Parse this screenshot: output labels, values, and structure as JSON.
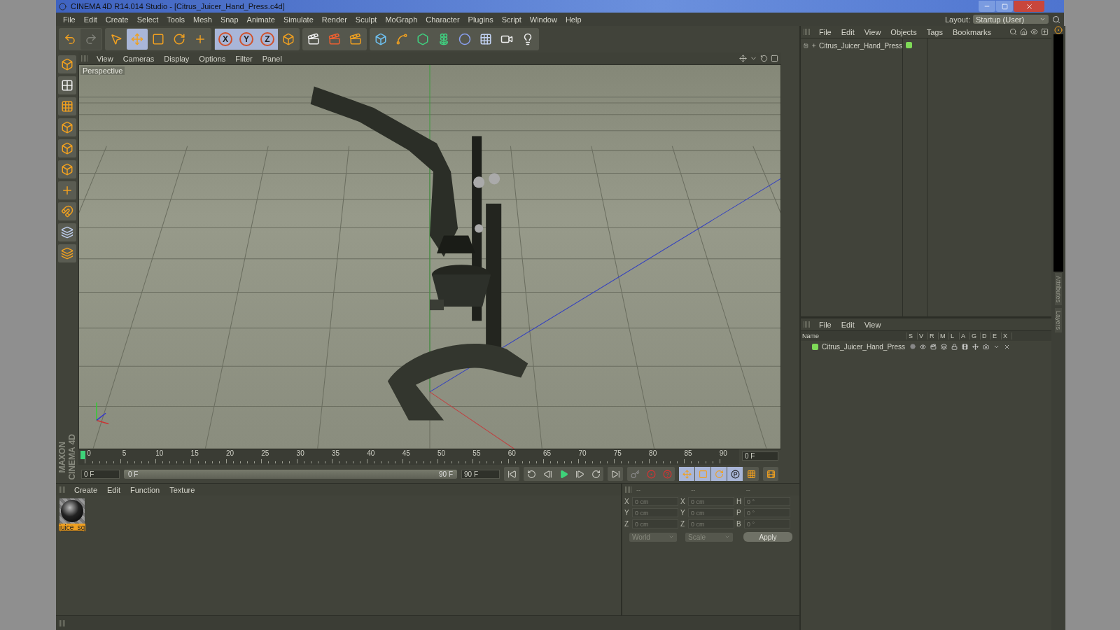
{
  "window": {
    "title": "CINEMA 4D R14.014 Studio - [Citrus_Juicer_Hand_Press.c4d]"
  },
  "menu": [
    "File",
    "Edit",
    "Create",
    "Select",
    "Tools",
    "Mesh",
    "Snap",
    "Animate",
    "Simulate",
    "Render",
    "Sculpt",
    "MoGraph",
    "Character",
    "Plugins",
    "Script",
    "Window",
    "Help"
  ],
  "layout": {
    "label": "Layout:",
    "value": "Startup (User)"
  },
  "toolbar": {
    "history": [
      {
        "kind": "undo",
        "disabled": false
      },
      {
        "kind": "redo",
        "disabled": true
      }
    ],
    "modes": [
      {
        "kind": "select",
        "selected": false
      },
      {
        "kind": "move",
        "selected": true
      },
      {
        "kind": "scale",
        "selected": false
      },
      {
        "kind": "rotate",
        "selected": false
      },
      {
        "kind": "recent",
        "selected": false
      }
    ],
    "axes": [
      {
        "label": "X",
        "selected": true
      },
      {
        "label": "Y",
        "selected": true
      },
      {
        "label": "Z",
        "selected": true
      }
    ]
  },
  "viewport": {
    "menu": [
      "View",
      "Cameras",
      "Display",
      "Options",
      "Filter",
      "Panel"
    ],
    "label": "Perspective"
  },
  "timeline": {
    "ticks": [
      "0",
      "5",
      "10",
      "15",
      "20",
      "25",
      "30",
      "35",
      "40",
      "45",
      "50",
      "55",
      "60",
      "65",
      "70",
      "75",
      "80",
      "85",
      "90"
    ],
    "current": "0 F",
    "start": "0 F",
    "range": {
      "start": "0 F",
      "end": "90 F",
      "level": 1
    },
    "end": "90 F"
  },
  "materials": {
    "menu": [
      "Create",
      "Edit",
      "Function",
      "Texture"
    ],
    "items": [
      {
        "name": "juice_sq",
        "selected": true
      }
    ]
  },
  "coordinates": {
    "headers": [
      "--",
      "--",
      "--"
    ],
    "rows": [
      {
        "labels": [
          "X",
          "X",
          "H"
        ],
        "values": [
          "0 cm",
          "0 cm",
          "0 °"
        ]
      },
      {
        "labels": [
          "Y",
          "Y",
          "P"
        ],
        "values": [
          "0 cm",
          "0 cm",
          "0 °"
        ]
      },
      {
        "labels": [
          "Z",
          "Z",
          "B"
        ],
        "values": [
          "0 cm",
          "0 cm",
          "0 °"
        ]
      }
    ],
    "dropdowns": [
      "World",
      "Scale"
    ],
    "apply": "Apply"
  },
  "objects": {
    "menu": [
      "File",
      "Edit",
      "View",
      "Objects",
      "Tags",
      "Bookmarks"
    ],
    "items": [
      {
        "name": "Citrus_Juicer_Hand_Press",
        "color": "#7ed957"
      }
    ]
  },
  "layers": {
    "menu": [
      "File",
      "Edit",
      "View"
    ],
    "columns": [
      "Name",
      "S",
      "V",
      "R",
      "M",
      "L",
      "A",
      "G",
      "D",
      "E",
      "X"
    ],
    "rows": [
      {
        "name": "Citrus_Juicer_Hand_Press",
        "color": "#7ed957"
      }
    ]
  },
  "side_tabs": [
    "Attributes",
    "Layers"
  ],
  "brand": [
    "MAXON",
    "CINEMA 4D"
  ]
}
